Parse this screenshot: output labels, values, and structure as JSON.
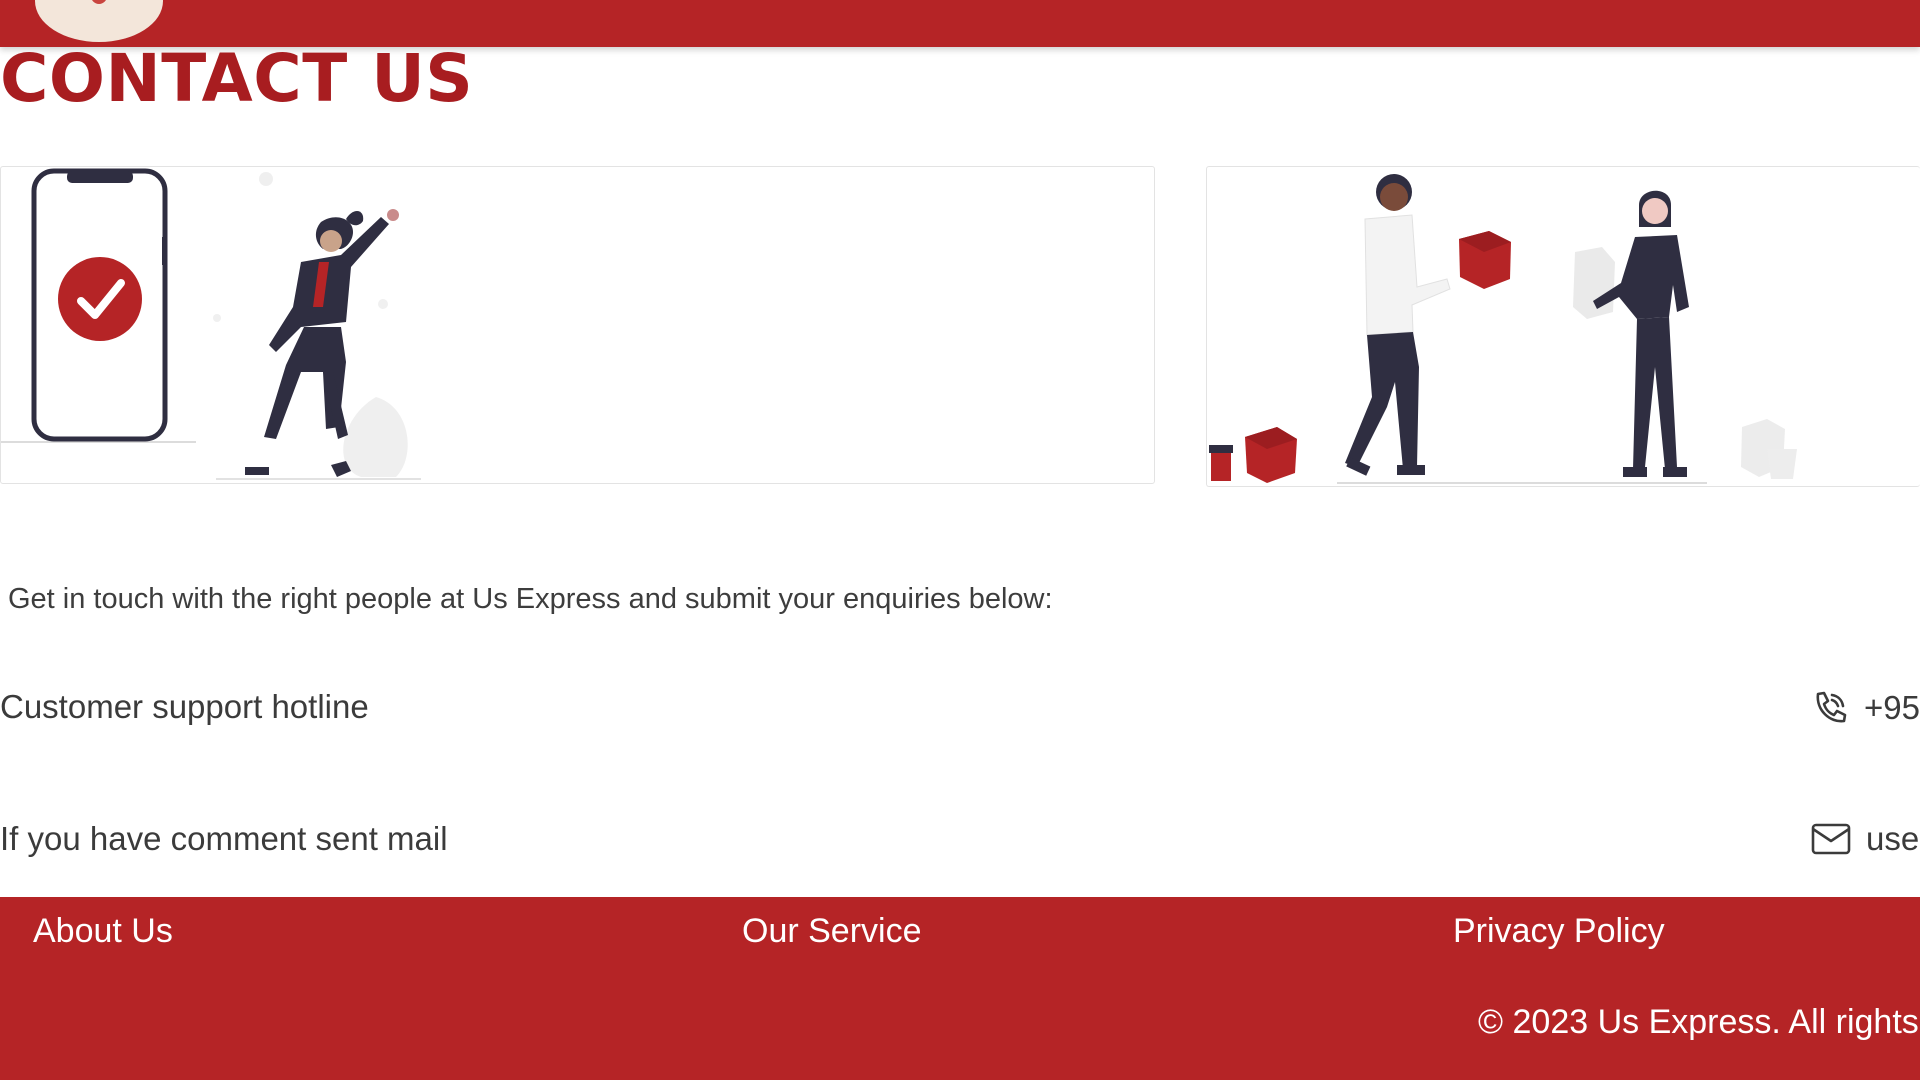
{
  "page": {
    "title": "CONTACT US"
  },
  "intro": "Get in touch with the right people at Us Express and submit your enquiries below:",
  "contacts": [
    {
      "label": "Customer support hotline",
      "icon": "phone-icon",
      "value": "+95"
    },
    {
      "label": "If you have comment sent mail",
      "icon": "mail-icon",
      "value": "use"
    }
  ],
  "footer": {
    "links": [
      "About Us",
      "Our Service",
      "Privacy Policy"
    ],
    "copyright": "© 2023 Us Express. All rights"
  },
  "colors": {
    "brand": "#b52426",
    "title": "#a81d20",
    "text": "#3b3b3b",
    "figure_dark": "#2f2e41",
    "card_border": "#e3e3e3"
  }
}
